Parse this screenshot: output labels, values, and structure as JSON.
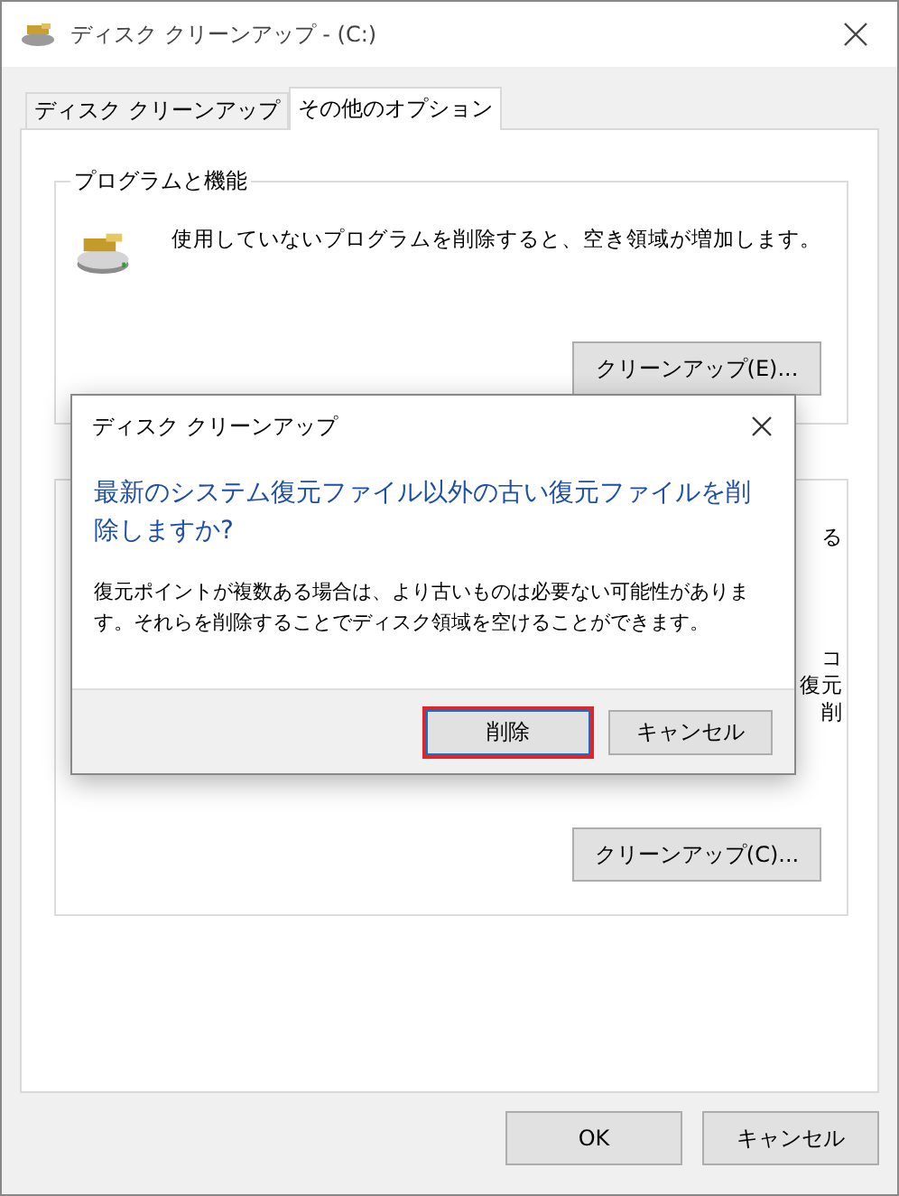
{
  "window": {
    "title": "ディスク クリーンアップ - (C:)"
  },
  "tabs": [
    {
      "label": "ディスク クリーンアップ",
      "selected": false
    },
    {
      "label": "その他のオプション",
      "selected": true
    }
  ],
  "program_group": {
    "title": "プログラムと機能",
    "description": "使用していないプログラムを削除すると、空き領域が増加します。",
    "button": "クリーンアップ(E)..."
  },
  "restore_group": {
    "fragments": [
      "る",
      "コ",
      "復元",
      "削"
    ],
    "button": "クリーンアップ(C)..."
  },
  "footer_buttons": [
    "OK",
    "キャンセル"
  ],
  "dialog": {
    "title": "ディスク クリーンアップ",
    "heading": "最新のシステム復元ファイル以外の古い復元ファイルを削除しますか?",
    "body": "復元ポイントが複数ある場合は、より古いものは必要ない可能性があります。それらを削除することでディスク領域を空けることができます。",
    "buttons": [
      {
        "label": "削除",
        "default": true
      },
      {
        "label": "キャンセル",
        "default": false
      }
    ]
  }
}
